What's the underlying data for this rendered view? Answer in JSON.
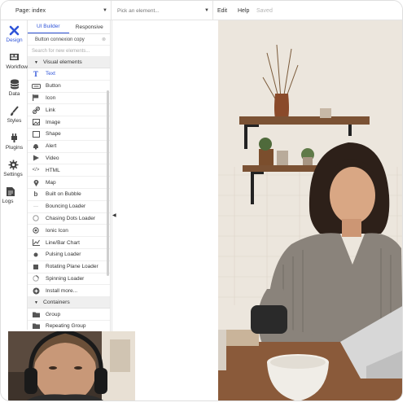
{
  "topbar": {
    "page_label": "Page: index",
    "element_placeholder": "Pick an element...",
    "menu": {
      "edit": "Edit",
      "help": "Help",
      "saved": "Saved"
    }
  },
  "rail": {
    "items": [
      {
        "label": "Design",
        "icon": "design-icon"
      },
      {
        "label": "Workflow",
        "icon": "workflow-icon"
      },
      {
        "label": "Data",
        "icon": "data-icon"
      },
      {
        "label": "Styles",
        "icon": "styles-icon"
      },
      {
        "label": "Plugins",
        "icon": "plugins-icon"
      },
      {
        "label": "Settings",
        "icon": "settings-icon"
      },
      {
        "label": "Logs",
        "icon": "logs-icon"
      }
    ]
  },
  "panel": {
    "tabs": {
      "ui_builder": "UI Builder",
      "responsive": "Responsive"
    },
    "copy_label": "Button connexion copy",
    "search_placeholder": "Search for new elements...",
    "visual_section": "Visual elements",
    "visual_items": [
      {
        "label": "Text",
        "icon": "text-icon"
      },
      {
        "label": "Button",
        "icon": "button-icon"
      },
      {
        "label": "Icon",
        "icon": "flag-icon"
      },
      {
        "label": "Link",
        "icon": "link-icon"
      },
      {
        "label": "Image",
        "icon": "image-icon"
      },
      {
        "label": "Shape",
        "icon": "shape-icon"
      },
      {
        "label": "Alert",
        "icon": "bell-icon"
      },
      {
        "label": "Video",
        "icon": "video-icon"
      },
      {
        "label": "HTML",
        "icon": "code-icon"
      },
      {
        "label": "Map",
        "icon": "map-pin-icon"
      },
      {
        "label": "Built on Bubble",
        "icon": "bubble-icon"
      },
      {
        "label": "Bouncing Loader",
        "icon": "dots-icon"
      },
      {
        "label": "Chasing Dots Loader",
        "icon": "circle-icon"
      },
      {
        "label": "Ionic Icon",
        "icon": "ionic-icon"
      },
      {
        "label": "Line/Bar Chart",
        "icon": "chart-icon"
      },
      {
        "label": "Pulsing Loader",
        "icon": "pulse-icon"
      },
      {
        "label": "Rotating Plane Loader",
        "icon": "square-icon"
      },
      {
        "label": "Spinning Loader",
        "icon": "spinner-icon"
      },
      {
        "label": "Install more...",
        "icon": "plus-circle-icon"
      }
    ],
    "containers_section": "Containers",
    "container_items": [
      {
        "label": "Group",
        "icon": "folder-icon"
      },
      {
        "label": "Repeating Group",
        "icon": "folder-icon"
      }
    ]
  },
  "colors": {
    "accent": "#2f54d8",
    "section_bg": "#efefef"
  }
}
